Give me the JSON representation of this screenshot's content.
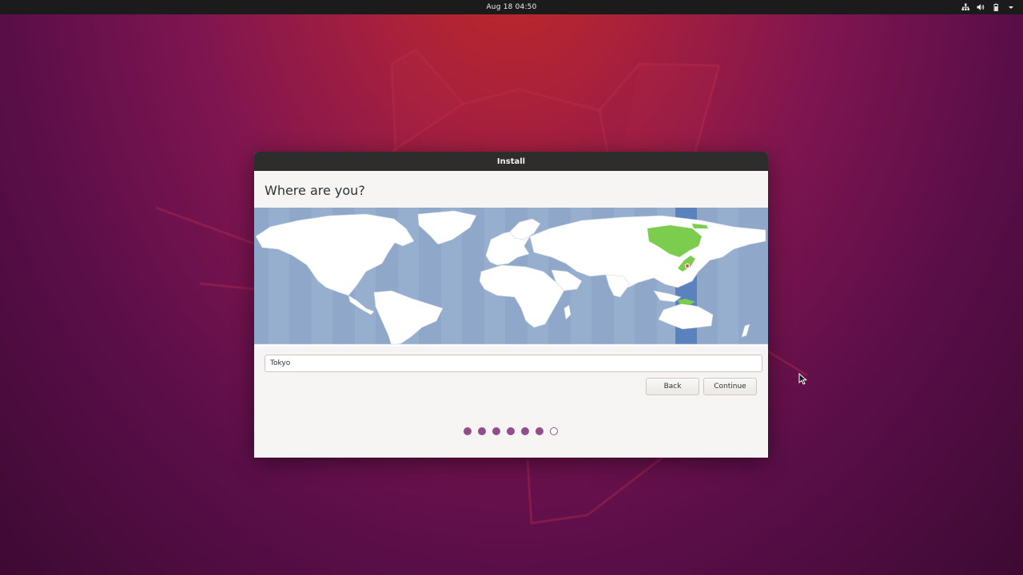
{
  "topbar": {
    "clock": "Aug 18  04:50",
    "tray_icons": [
      "network-icon",
      "volume-icon",
      "battery-icon",
      "menu-arrow-icon"
    ]
  },
  "window": {
    "title": "Install",
    "heading": "Where are you?"
  },
  "location": {
    "value": "Tokyo",
    "selected_timezone": "Asia/Tokyo"
  },
  "buttons": {
    "back_label": "Back",
    "continue_label": "Continue"
  },
  "progress": {
    "total_steps": 7,
    "completed_steps": 6
  },
  "colors": {
    "accent": "#924d8b",
    "map_ocean": "#8fa7c9",
    "timezone_highlight": "#5a82bd",
    "selected_region": "#7ccc4e",
    "land": "#ffffff"
  }
}
